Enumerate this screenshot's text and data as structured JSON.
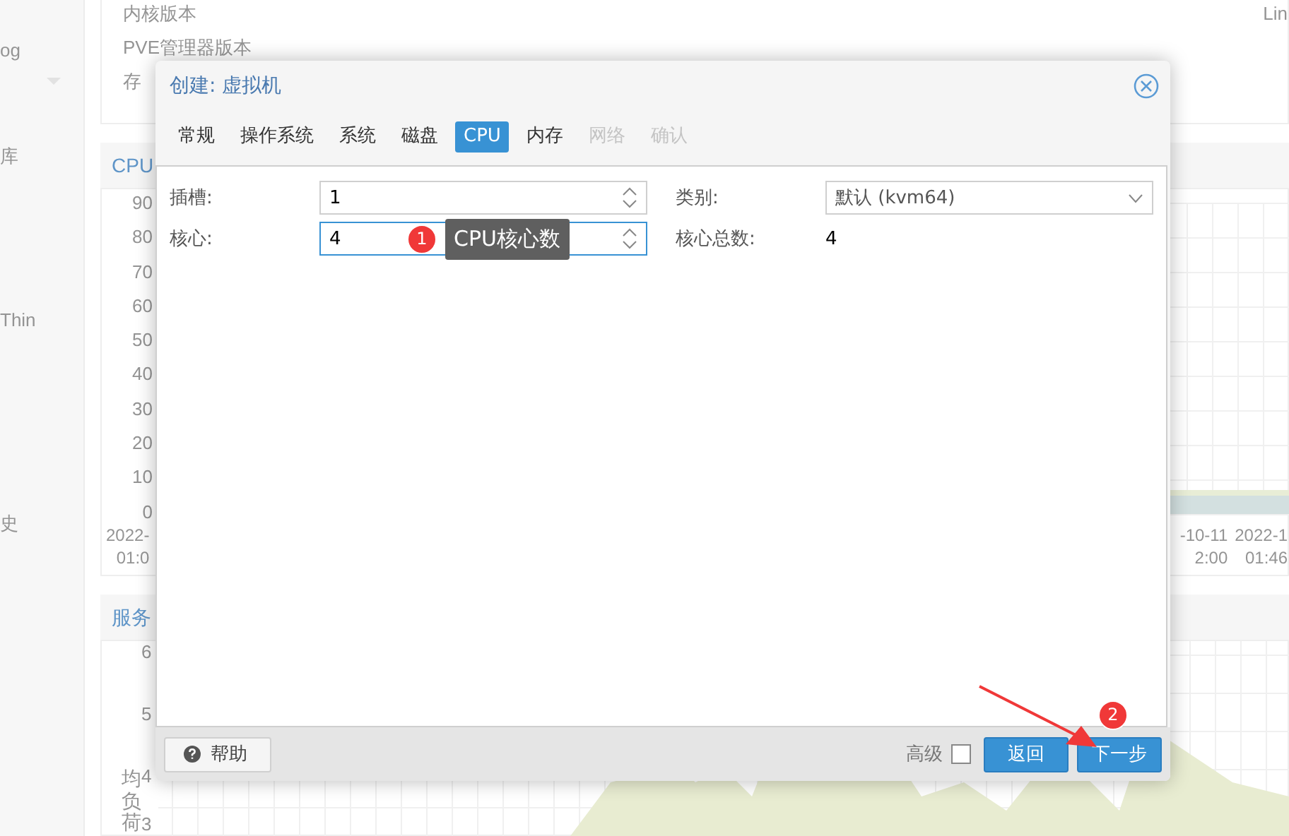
{
  "background": {
    "sidebar_fragments": [
      "og",
      "库",
      "Thin",
      "史"
    ],
    "info_rows": [
      "内核版本",
      "PVE管理器版本",
      "存"
    ],
    "info_value": "Lin",
    "cpu_panel": {
      "title": "CPU",
      "y_ticks": [
        "90",
        "80",
        "70",
        "60",
        "50",
        "40",
        "30",
        "20",
        "10",
        "0"
      ],
      "x_labels_left": [
        "2022-",
        "01:0"
      ],
      "x_labels_right": [
        [
          "-10-11",
          "2:00"
        ],
        [
          "2022-1",
          "01:46"
        ]
      ]
    },
    "load_panel": {
      "title": "服务",
      "y_ticks": [
        "6",
        "5",
        "4",
        "3"
      ],
      "axis_label": "均负荷"
    }
  },
  "dialog": {
    "title": "创建: 虚拟机",
    "tabs": [
      {
        "label": "常规",
        "selected": false,
        "disabled": false
      },
      {
        "label": "操作系统",
        "selected": false,
        "disabled": false
      },
      {
        "label": "系统",
        "selected": false,
        "disabled": false
      },
      {
        "label": "磁盘",
        "selected": false,
        "disabled": false
      },
      {
        "label": "CPU",
        "selected": true,
        "disabled": false
      },
      {
        "label": "内存",
        "selected": false,
        "disabled": false
      },
      {
        "label": "网络",
        "selected": false,
        "disabled": true
      },
      {
        "label": "确认",
        "selected": false,
        "disabled": true
      }
    ],
    "left_fields": [
      {
        "label": "插槽:",
        "kind": "spinner",
        "value": "1",
        "focused": false
      },
      {
        "label": "核心:",
        "kind": "spinner",
        "value": "4",
        "focused": true
      }
    ],
    "right_fields": [
      {
        "label": "类别:",
        "kind": "select",
        "value": "默认 (kvm64)"
      },
      {
        "label": "核心总数:",
        "kind": "display",
        "value": "4"
      }
    ],
    "footer": {
      "help": "帮助",
      "advanced": {
        "label": "高级",
        "checked": false
      },
      "back": "返回",
      "next": "下一步"
    }
  },
  "annotations": [
    {
      "number": "1",
      "text": "CPU核心数"
    },
    {
      "number": "2"
    }
  ]
}
